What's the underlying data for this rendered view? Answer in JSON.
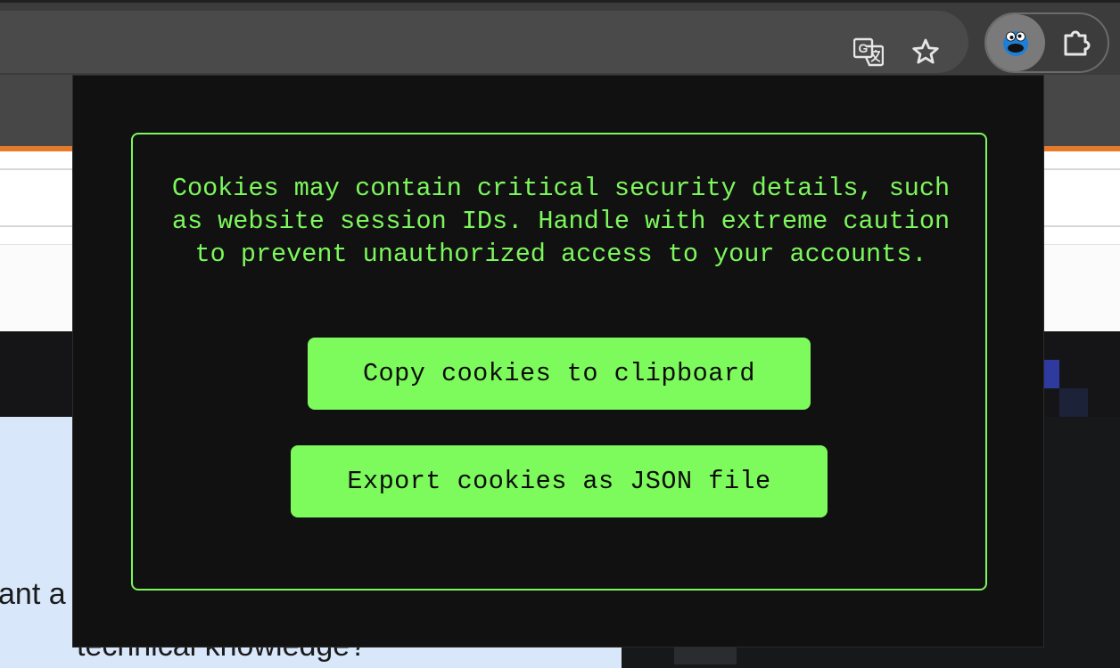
{
  "browser": {
    "toolbar_icons": [
      "translate-icon",
      "star-icon"
    ],
    "extensions": [
      "cookie-monster-extension-icon",
      "puzzle-extensions-icon"
    ]
  },
  "background_page": {
    "text_line1": "ant a",
    "text_line2": "technical knowledge?"
  },
  "popup": {
    "warning": "Cookies may contain critical security details, such as website session IDs. Handle with extreme caution to prevent unauthorized access to your accounts.",
    "copy_button": "Copy cookies to clipboard",
    "export_button": "Export cookies as JSON file",
    "accent_color": "#7cf75c",
    "background_color": "#111111"
  }
}
